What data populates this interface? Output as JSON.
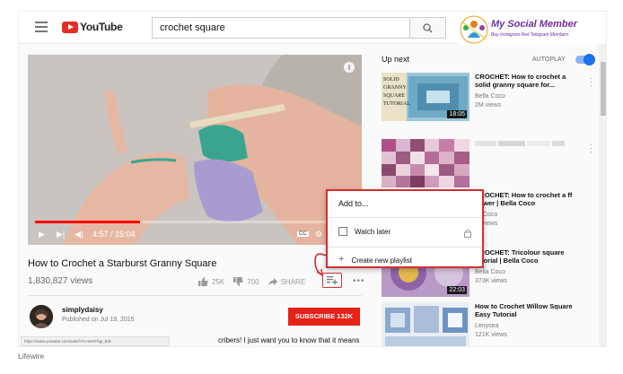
{
  "header": {
    "logo_text": "YouTube",
    "search_value": "crochet square"
  },
  "brand": {
    "title": "My Social Member",
    "subtitle": "Buy Instagram And Telegram Members"
  },
  "player": {
    "time": "4:57 / 15:04",
    "progress": 0.33
  },
  "video": {
    "title": "How to Crochet a Starburst Granny Square",
    "views": "1,830,827 views",
    "likes": "25K",
    "dislikes": "700",
    "share": "SHARE"
  },
  "channel": {
    "name": "simplydaisy",
    "published": "Published on Jul 19, 2015",
    "subscribe": "SUBSCRIBE 132K",
    "description": "cribers! I just want you to know that it means"
  },
  "status_url": "https://www.youtube.com/watch?v=WmFfqp_bdc",
  "sidebar": {
    "up_next": "Up next",
    "autoplay": "AUTOPLAY",
    "videos": [
      {
        "title": "CROCHET: How to crochet a solid granny square for...",
        "channel": "Bella Coco",
        "views": "2M views",
        "duration": "18:05",
        "thumb_text": [
          "SOLID",
          "GRANNY",
          "SQUARE",
          "TUTORIAL"
        ]
      },
      {
        "title": "",
        "channel": "",
        "views": "",
        "duration": ""
      },
      {
        "title": "CROCHET: How to crochet a ff flower | Bella Coco",
        "channel": "lla Coco",
        "views": "M views",
        "duration": ""
      },
      {
        "title": "CROCHET: Tricolour square tutorial | Bella Coco",
        "channel": "Bella Coco",
        "views": "373K views",
        "duration": "22:03"
      },
      {
        "title": "How to Crochet Willow Square Easy Tutorial",
        "channel": "Lenysea",
        "views": "121K views",
        "duration": ""
      }
    ]
  },
  "popup": {
    "title": "Add to...",
    "watch_later": "Watch later",
    "create_playlist": "Create new playlist"
  },
  "caption": "Lifewire",
  "colors": {
    "accent": "#e62117",
    "highlight": "#d32f2f",
    "link_blue": "#1a73e8"
  }
}
